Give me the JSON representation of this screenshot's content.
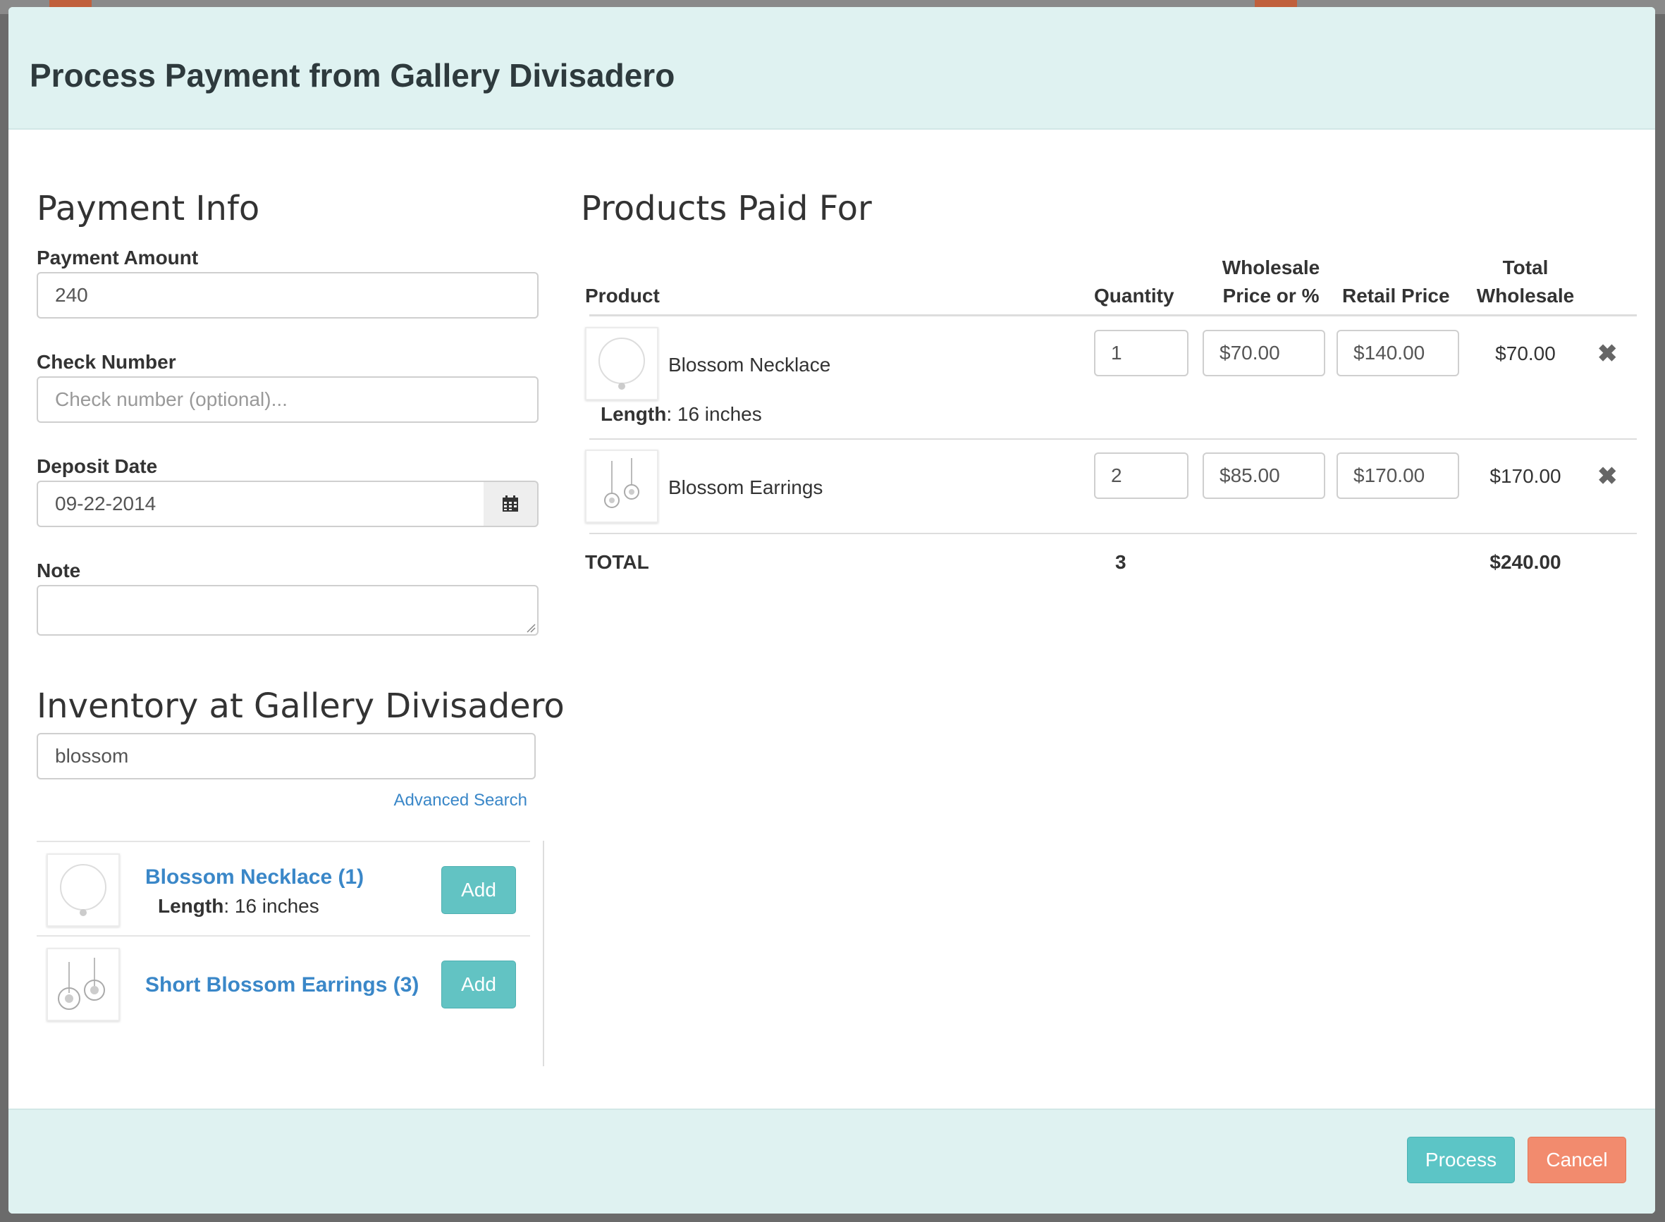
{
  "modal": {
    "title": "Process Payment from Gallery Divisadero"
  },
  "payment_info": {
    "heading": "Payment Info",
    "amount_label": "Payment Amount",
    "amount_value": "240",
    "check_label": "Check Number",
    "check_placeholder": "Check number (optional)...",
    "deposit_label": "Deposit Date",
    "deposit_value": "09-22-2014",
    "note_label": "Note",
    "note_value": ""
  },
  "inventory": {
    "heading": "Inventory at Gallery Divisadero",
    "search_value": "blossom",
    "advanced_search": "Advanced Search",
    "items": [
      {
        "name": "Blossom Necklace (1)",
        "attr_label": "Length",
        "attr_value": ": 16 inches",
        "add_label": "Add",
        "thumb_icon": "necklace-icon"
      },
      {
        "name": "Short Blossom Earrings (3)",
        "attr_label": "",
        "attr_value": "",
        "add_label": "Add",
        "thumb_icon": "earrings-icon"
      }
    ]
  },
  "products": {
    "heading": "Products Paid For",
    "columns": {
      "product": "Product",
      "quantity": "Quantity",
      "wholesale_line1": "Wholesale",
      "wholesale_line2": "Price or %",
      "retail": "Retail Price",
      "total_line1": "Total",
      "total_line2": "Wholesale"
    },
    "rows": [
      {
        "name": "Blossom Necklace",
        "attr_label": "Length",
        "attr_value": ": 16 inches",
        "quantity": "1",
        "wholesale": "$70.00",
        "retail": "$140.00",
        "total": "$70.00",
        "thumb_icon": "necklace-icon"
      },
      {
        "name": "Blossom Earrings",
        "attr_label": "",
        "attr_value": "",
        "quantity": "2",
        "wholesale": "$85.00",
        "retail": "$170.00",
        "total": "$170.00",
        "thumb_icon": "earrings-icon"
      }
    ],
    "total_label": "TOTAL",
    "total_quantity": "3",
    "total_wholesale": "$240.00",
    "remove_icon": "close-icon"
  },
  "footer": {
    "process_label": "Process",
    "cancel_label": "Cancel"
  },
  "colors": {
    "header_bg": "#dff2f1",
    "accent_teal": "#5cc5c6",
    "cancel_orange": "#f28b6e",
    "link_blue": "#3a87c8"
  }
}
